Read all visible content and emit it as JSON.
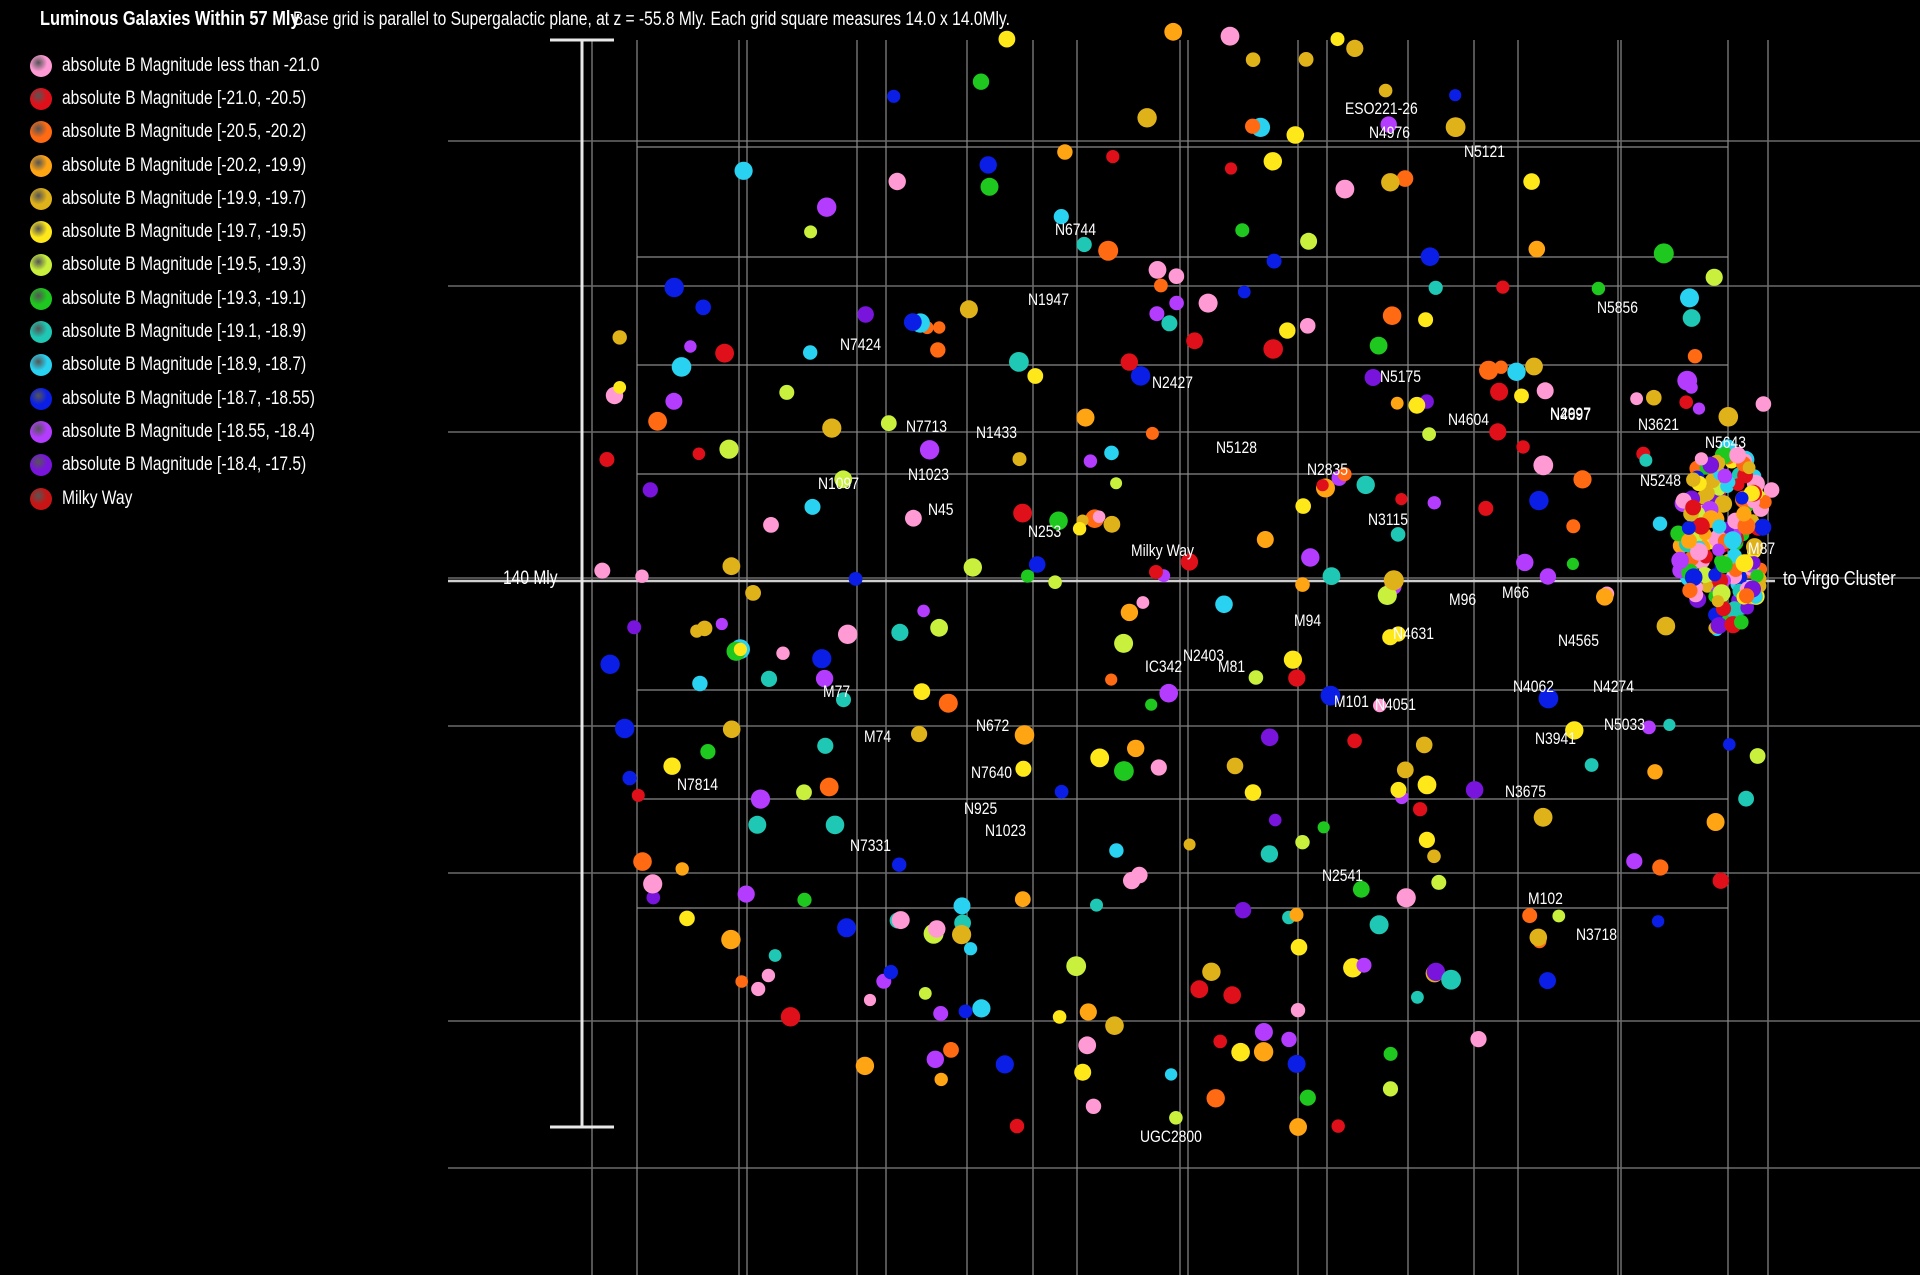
{
  "header": {
    "title": "Luminous Galaxies Within 57 Mly",
    "subtitle": "Base grid is parallel to Supergalactic plane, at z = -55.8 Mly. Each grid square measures 14.0 x 14.0Mly."
  },
  "legend": [
    {
      "label": "absolute B Magnitude less than -21.0",
      "color": "#ff9ad5"
    },
    {
      "label": "absolute B Magnitude [-21.0, -20.5)",
      "color": "#e0101a"
    },
    {
      "label": "absolute B Magnitude [-20.5, -20.2)",
      "color": "#ff6a12"
    },
    {
      "label": "absolute B Magnitude [-20.2, -19.9)",
      "color": "#ffa514"
    },
    {
      "label": "absolute B Magnitude [-19.9, -19.7)",
      "color": "#e0b21a"
    },
    {
      "label": "absolute B Magnitude [-19.7, -19.5)",
      "color": "#ffe81a"
    },
    {
      "label": "absolute B Magnitude [-19.5, -19.3)",
      "color": "#c8f03c"
    },
    {
      "label": "absolute B Magnitude [-19.3, -19.1)",
      "color": "#1ec81e"
    },
    {
      "label": "absolute B Magnitude [-19.1, -18.9)",
      "color": "#1ec8b4"
    },
    {
      "label": "absolute B Magnitude [-18.9, -18.7)",
      "color": "#28d2f0"
    },
    {
      "label": "absolute B Magnitude [-18.7, -18.55)",
      "color": "#0a1ee6"
    },
    {
      "label": "absolute B Magnitude [-18.55, -18.4)",
      "color": "#b43cff"
    },
    {
      "label": "absolute B Magnitude [-18.4, -17.5)",
      "color": "#7814dc"
    },
    {
      "label": "Milky Way",
      "color": "#c81414"
    }
  ],
  "scale_label": "140 Mly",
  "direction_label": "to Virgo Cluster",
  "galaxy_labels": [
    "ESO221-26",
    "N4976",
    "N5121",
    "N6744",
    "N1947",
    "N7424",
    "N5856",
    "N2997",
    "N5175",
    "N2427",
    "N7713",
    "N1433",
    "N5128",
    "N4604",
    "N4697",
    "N3621",
    "N5643",
    "N1097",
    "N1023",
    "N45",
    "N2835",
    "N5248",
    "N253",
    "N3115",
    "Milky Way",
    "M87",
    "M66",
    "M96",
    "N4631",
    "M94",
    "N4565",
    "IC342",
    "N2403",
    "M81",
    "M101",
    "N4051",
    "N4062",
    "N4274",
    "M77",
    "N5033",
    "M74",
    "N672",
    "N3941",
    "N7814",
    "N7640",
    "N3675",
    "N925",
    "N7331",
    "N1023",
    "N2541",
    "M102",
    "N3718",
    "UGC2800"
  ]
}
